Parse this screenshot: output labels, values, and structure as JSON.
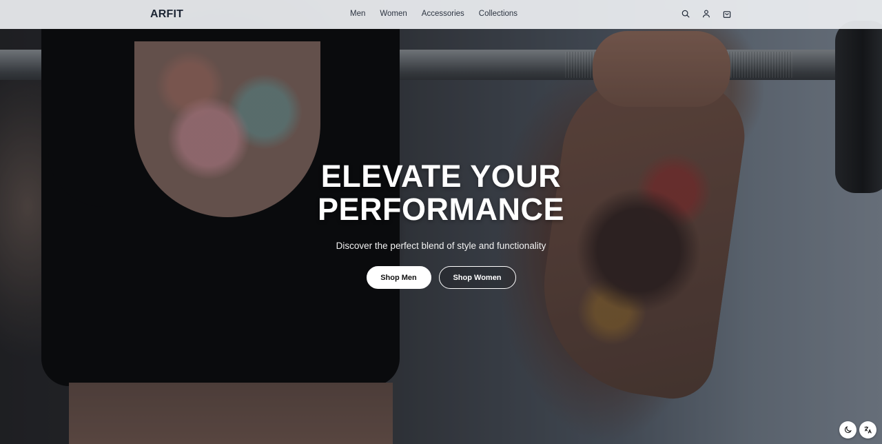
{
  "brand": {
    "logo": "ARFIT"
  },
  "nav": {
    "items": [
      {
        "label": "Men"
      },
      {
        "label": "Women"
      },
      {
        "label": "Accessories"
      },
      {
        "label": "Collections"
      }
    ],
    "icons": [
      "search-icon",
      "user-icon",
      "shopping-bag-icon"
    ]
  },
  "hero": {
    "title_line1": "ELEVATE YOUR",
    "title_line2": "PERFORMANCE",
    "subtitle": "Discover the perfect blend of style and functionality",
    "primary_cta": "Shop Men",
    "secondary_cta": "Shop Women"
  },
  "floating": {
    "icons": [
      "moon-icon",
      "translate-icon"
    ]
  },
  "colors": {
    "nav_bg": "#eceef1",
    "text_dark": "#1b2433",
    "cta_primary_bg": "#ffffff"
  }
}
